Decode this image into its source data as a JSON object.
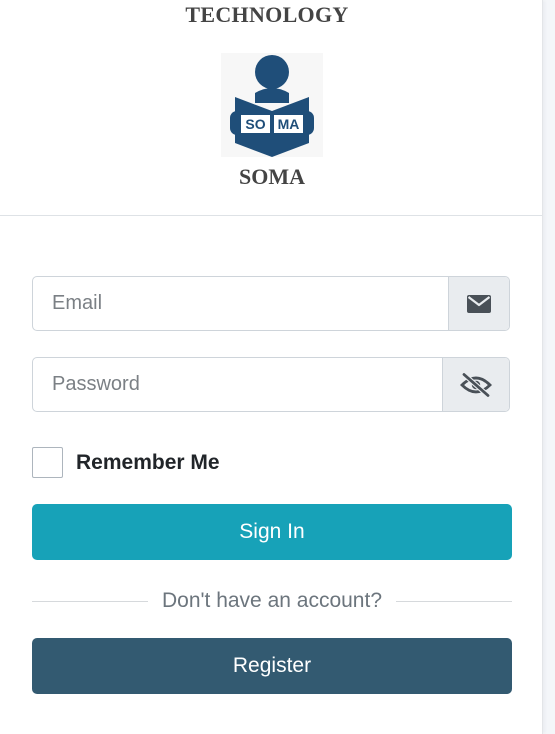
{
  "brand": {
    "top_text": "TECHNOLOGY",
    "bottom_text": "SOMA",
    "logo_text_left": "SO",
    "logo_text_right": "MA",
    "logo_color": "#1f4e79"
  },
  "form": {
    "email_placeholder": "Email",
    "email_value": "",
    "password_placeholder": "Password",
    "password_value": "",
    "remember_label": "Remember Me",
    "remember_checked": false,
    "signin_label": "Sign In",
    "divider_text": "Don't have an account?",
    "register_label": "Register"
  },
  "icons": {
    "email": "envelope-icon",
    "password": "eye-slash-icon"
  },
  "colors": {
    "signin": "#17a2b8",
    "register": "#335a71"
  }
}
